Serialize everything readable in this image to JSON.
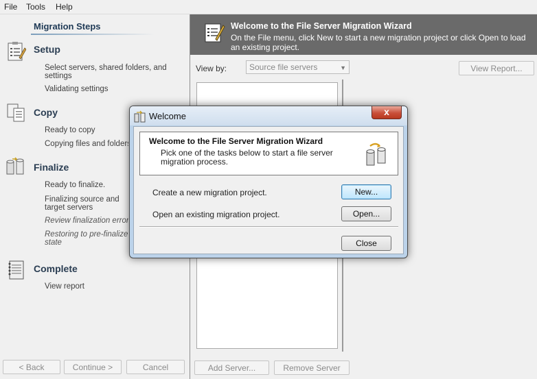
{
  "menu": [
    "File",
    "Tools",
    "Help"
  ],
  "steps": {
    "title": "Migration Steps",
    "setup": {
      "title": "Setup",
      "items": [
        "Select servers, shared folders, and settings",
        "Validating settings"
      ]
    },
    "copy": {
      "title": "Copy",
      "items": [
        "Ready to copy",
        "Copying files and folders"
      ]
    },
    "finalize": {
      "title": "Finalize",
      "items": [
        "Ready to finalize.",
        "Finalizing source and target servers",
        "Review finalization errors",
        "Restoring to pre-finalize state"
      ]
    },
    "complete": {
      "title": "Complete",
      "items": [
        "View report"
      ]
    }
  },
  "nav": {
    "back": "< Back",
    "continue": "Continue >",
    "cancel": "Cancel"
  },
  "header": {
    "title": "Welcome to the File Server Migration Wizard",
    "description": "On the File menu, click New to start a new migration project or click Open to load an existing project."
  },
  "main": {
    "view_by_label": "View by:",
    "view_by_value": "Source file servers",
    "view_report": "View Report...",
    "add_server": "Add Server...",
    "remove_server": "Remove Server"
  },
  "dialog": {
    "title": "Welcome",
    "close_glyph": "x",
    "intro_title": "Welcome to the File Server Migration Wizard",
    "intro_text": "Pick one of the tasks below to start a file server migration process.",
    "new_label": "Create a new migration project.",
    "new_button": "New...",
    "open_label": "Open an existing migration project.",
    "open_button": "Open...",
    "close_button": "Close"
  }
}
